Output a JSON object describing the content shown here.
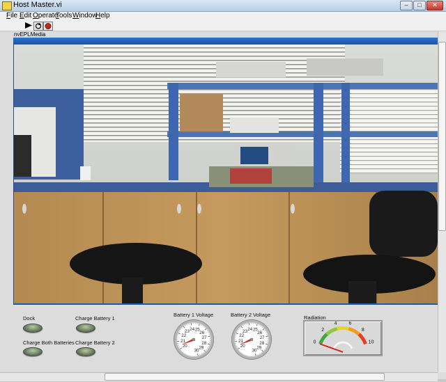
{
  "window": {
    "title": "Host Master.vi",
    "controls": {
      "minimize": "–",
      "maximize": "□",
      "close": "✕"
    }
  },
  "menu": [
    "File",
    "Edit",
    "Operate",
    "Tools",
    "Window",
    "Help"
  ],
  "toolbar": {
    "run_icon": "run-arrow-icon",
    "continuous_icon": "run-continuously-icon",
    "abort_icon": "abort-icon"
  },
  "media": {
    "label": "nvEPLMedia"
  },
  "controls": {
    "dock": "Dock",
    "charge_battery_1": "Charge Battery 1",
    "charge_both": "Charge Both Batteries",
    "charge_battery_2": "Charge Battery 2"
  },
  "gauges": [
    {
      "label": "Battery 1 Voltage",
      "ticks": [
        "20",
        "21",
        "22",
        "23",
        "24",
        "25",
        "26",
        "27",
        "28",
        "29",
        "30"
      ],
      "min": 20,
      "max": 30,
      "value": 20.4
    },
    {
      "label": "Battery 2 Voltage",
      "ticks": [
        "20",
        "21",
        "22",
        "23",
        "24",
        "25",
        "26",
        "27",
        "28",
        "29",
        "30"
      ],
      "min": 20,
      "max": 30,
      "value": 20.4
    }
  ],
  "radiation": {
    "label": "Radiation",
    "ticks": [
      "0",
      "2",
      "4",
      "6",
      "8",
      "10"
    ],
    "min": 0,
    "max": 10,
    "value": 0
  },
  "colors": {
    "media_border": "#1f5fb3",
    "needle": "#d42a1d",
    "led_off": "#6d8463"
  }
}
